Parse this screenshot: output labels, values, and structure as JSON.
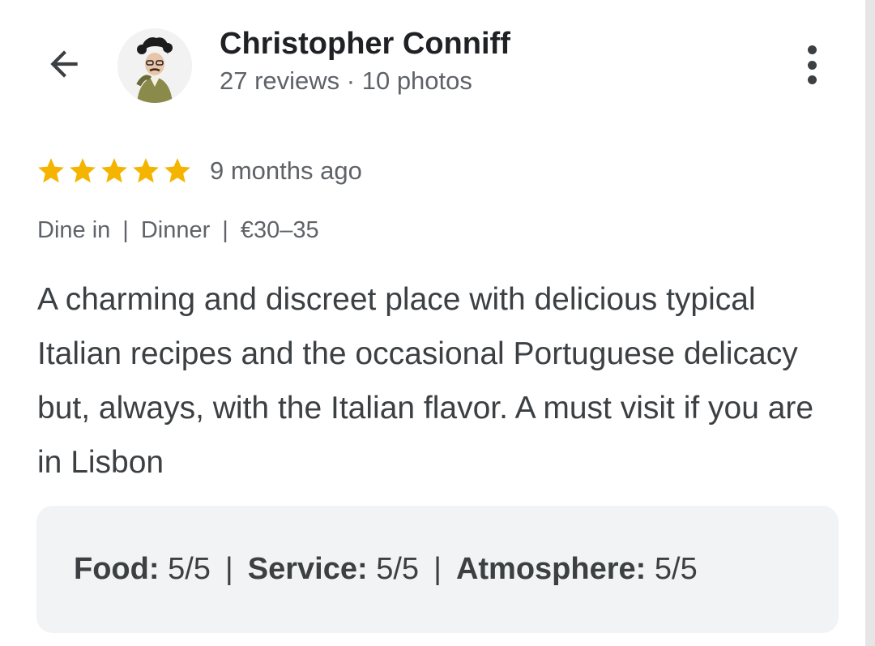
{
  "header": {
    "user_name": "Christopher Conniff",
    "user_stats": "27 reviews · 10 photos",
    "back_icon": "arrow-back-icon",
    "more_icon": "more-vert-icon"
  },
  "review": {
    "star_rating": 5,
    "star_max": 5,
    "star_color": "#f4b400",
    "date": "9 months ago",
    "meta": {
      "service_type": "Dine in",
      "meal_type": "Dinner",
      "price": "€30–35",
      "separator": "|"
    },
    "text": "A charming and discreet place with delicious typical Italian recipes and the occasional Portuguese delicacy but, always, with the Italian flavor. A must visit if you are in Lisbon"
  },
  "ratings": {
    "separator": "|",
    "items": [
      {
        "label": "Food:",
        "value": "5/5"
      },
      {
        "label": "Service:",
        "value": "5/5"
      },
      {
        "label": "Atmosphere:",
        "value": "5/5"
      }
    ]
  },
  "colors": {
    "text_primary": "#202124",
    "text_secondary": "#5f6368",
    "text_body": "#3c4043",
    "ratings_box_bg": "#f1f3f4"
  }
}
